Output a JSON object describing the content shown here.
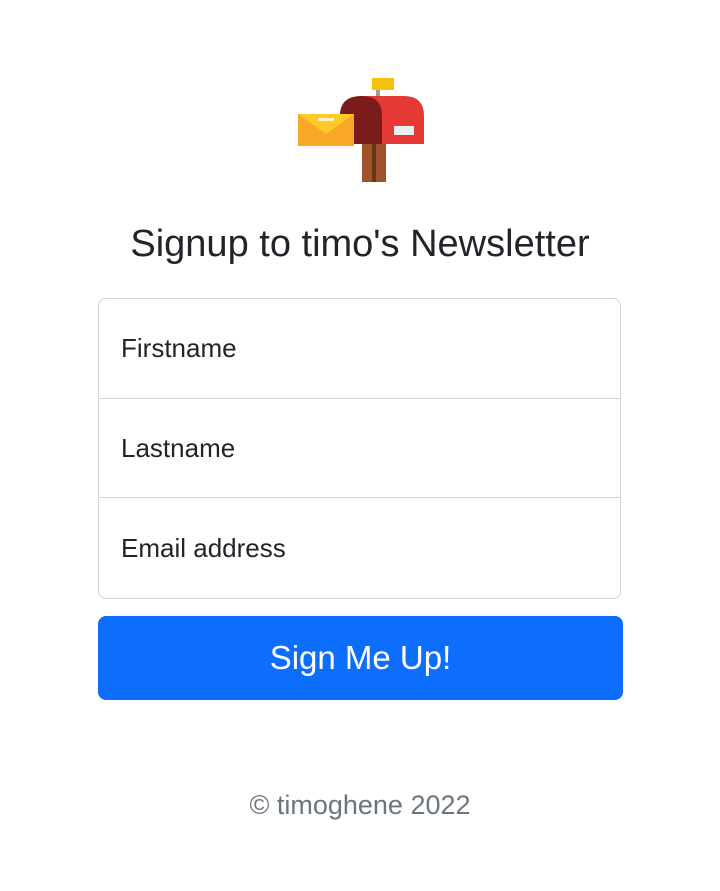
{
  "header": {
    "logo_icon": "mailbox-icon",
    "title": "Signup to timo's Newsletter"
  },
  "form": {
    "firstname_placeholder": "Firstname",
    "lastname_placeholder": "Lastname",
    "email_placeholder": "Email address",
    "submit_label": "Sign Me Up!"
  },
  "footer": {
    "copyright": "© timoghene 2022"
  },
  "colors": {
    "accent": "#0d6efd",
    "text": "#212529",
    "muted": "#6c757d",
    "border": "#ced4da"
  }
}
